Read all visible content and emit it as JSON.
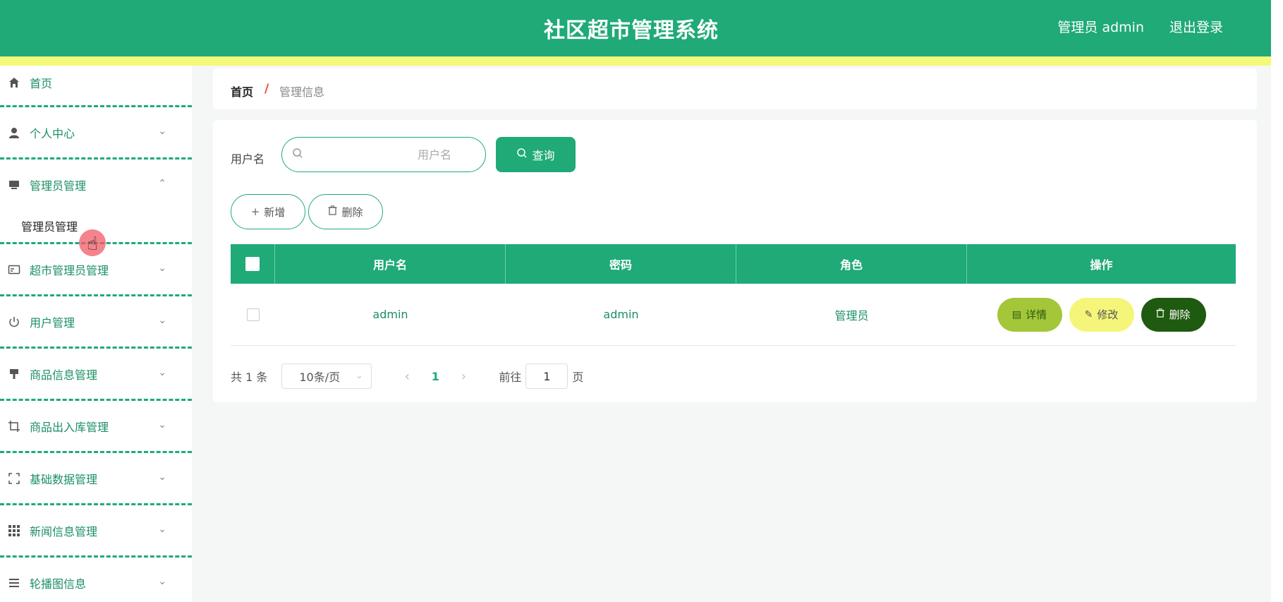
{
  "header": {
    "title": "社区超市管理系统",
    "user_label": "管理员 admin",
    "logout": "退出登录"
  },
  "sidebar": {
    "items": [
      {
        "label": "首页",
        "icon": "home-icon"
      },
      {
        "label": "个人中心",
        "icon": "user-icon"
      },
      {
        "label": "管理员管理",
        "icon": "monitor-icon",
        "expanded": true,
        "children": [
          "管理员管理"
        ]
      },
      {
        "label": "超市管理员管理",
        "icon": "card-icon"
      },
      {
        "label": "用户管理",
        "icon": "power-icon"
      },
      {
        "label": "商品信息管理",
        "icon": "brush-icon"
      },
      {
        "label": "商品出入库管理",
        "icon": "crop-icon"
      },
      {
        "label": "基础数据管理",
        "icon": "fullscreen-icon"
      },
      {
        "label": "新闻信息管理",
        "icon": "grid-icon"
      },
      {
        "label": "轮播图信息",
        "icon": "list-icon"
      }
    ]
  },
  "breadcrumb": {
    "home": "首页",
    "separator": "/",
    "current": "管理信息"
  },
  "search": {
    "label": "用户名",
    "placeholder": "用户名",
    "query_button": "查询"
  },
  "actions": {
    "add": "新增",
    "delete": "删除"
  },
  "table": {
    "headers": [
      "用户名",
      "密码",
      "角色",
      "操作"
    ],
    "rows": [
      {
        "username": "admin",
        "password": "admin",
        "role": "管理员"
      }
    ],
    "row_actions": {
      "detail": "详情",
      "edit": "修改",
      "delete": "删除"
    }
  },
  "pagination": {
    "total": "共 1 条",
    "page_size": "10条/页",
    "current_page": "1",
    "goto_label": "前往",
    "goto_value": "1",
    "page_suffix": "页"
  },
  "colors": {
    "primary": "#1faa77",
    "strip": "#f4f97a",
    "detail": "#a4c639",
    "edit": "#f5f57a",
    "delete": "#1e5a0f"
  }
}
